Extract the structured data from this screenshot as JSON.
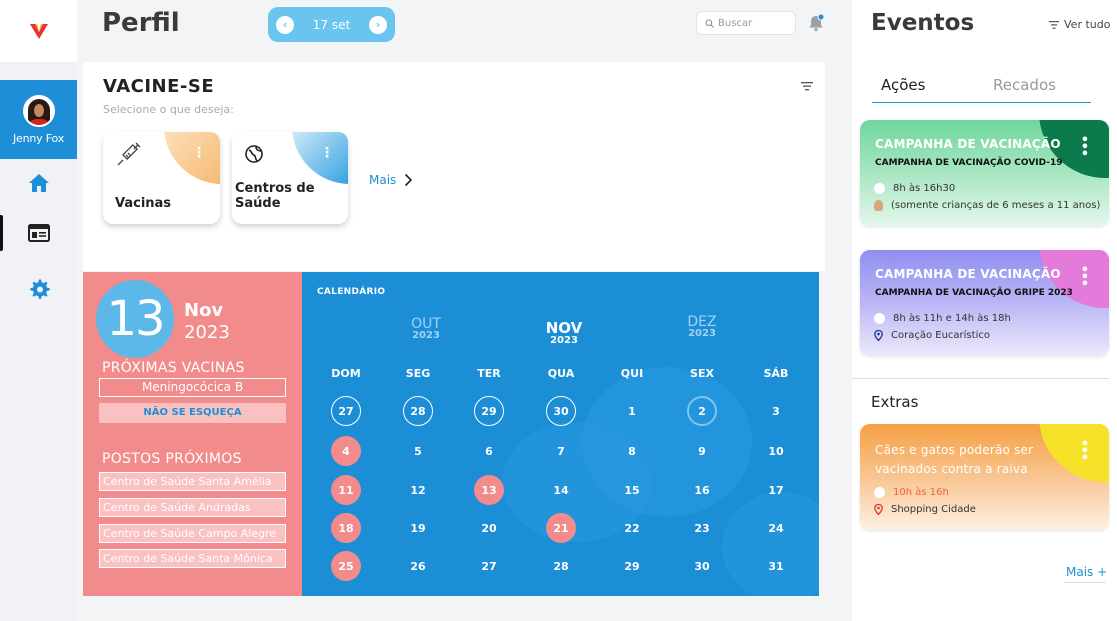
{
  "sidebar": {
    "user_name": "Jenny Fox"
  },
  "header": {
    "title": "Perfil",
    "date": "17 set",
    "search_placeholder": "Buscar"
  },
  "vaccines": {
    "title": "VACINE-SE",
    "subtitle": "Selecione o que deseja:",
    "cards": [
      {
        "label": "Vacinas",
        "icon": "syringe-icon"
      },
      {
        "label": "Centros de Saúde",
        "icon": "globe-icon"
      }
    ],
    "more_label": "Mais"
  },
  "highlight": {
    "day": "13",
    "month": "Nov",
    "year": "2023",
    "next_vaccines_label": "PRÓXIMAS VACINAS",
    "next_vaccine": "Meningocócica B",
    "reminder": "NÃO SE ESQUEÇA",
    "nearby_label": "POSTOS PRÓXIMOS",
    "nearby": [
      "Centro de Saúde Santa Amélia",
      "Centro de Saúde Andradas",
      "Centro de Saúde Campo Alegre",
      "Centro de Saúde Santa Mônica"
    ]
  },
  "calendar": {
    "label": "CALENDÁRIO",
    "months": [
      {
        "name": "OUT",
        "year": "2023"
      },
      {
        "name": "NOV",
        "year": "2023"
      },
      {
        "name": "DEZ",
        "year": "2023"
      }
    ],
    "weekdays": [
      "DOM",
      "SEG",
      "TER",
      "QUA",
      "QUI",
      "SEX",
      "SÁB"
    ],
    "weeks": [
      [
        "27",
        "28",
        "29",
        "30",
        "1",
        "2",
        "3"
      ],
      [
        "4",
        "5",
        "6",
        "7",
        "8",
        "9",
        "10"
      ],
      [
        "11",
        "12",
        "13",
        "14",
        "15",
        "16",
        "17"
      ],
      [
        "18",
        "19",
        "20",
        "21",
        "22",
        "23",
        "24"
      ],
      [
        "25",
        "26",
        "27",
        "28",
        "29",
        "30",
        "31"
      ]
    ],
    "highlighted_days": [
      "4",
      "11",
      "13",
      "18",
      "21",
      "25"
    ],
    "today": "2"
  },
  "events": {
    "title": "Eventos",
    "see_all": "Ver tudo",
    "tabs": [
      "Ações",
      "Recados"
    ],
    "items": [
      {
        "title": "CAMPANHA DE VACINAÇÃO",
        "subtitle": "CAMPANHA DE VACINAÇÃO COVID-19",
        "time": "8h às 16h30",
        "detail": "(somente crianças de 6 meses a 11 anos)",
        "gradient": [
          "#6fd69c",
          "#bdeed0"
        ],
        "blob": "#0c7a4d"
      },
      {
        "title": "CAMPANHA DE VACINAÇÃO",
        "subtitle": "CAMPANHA DE VACINAÇÃO GRIPE 2023",
        "time": "8h às 11h e 14h às 18h",
        "detail": "Coração Eucarístico",
        "gradient": [
          "#8f8ef0",
          "#d7d3f9"
        ],
        "blob": "#e47ad9"
      }
    ],
    "extras_label": "Extras",
    "extras": [
      {
        "title": "Cães e gatos poderão ser vacinados contra a raiva",
        "time": "10h às 16h",
        "place": "Shopping Cidade",
        "gradient": [
          "#f6a044",
          "#fbd8b4"
        ],
        "blob": "#f7e22a"
      }
    ],
    "more_label": "Mais +"
  }
}
